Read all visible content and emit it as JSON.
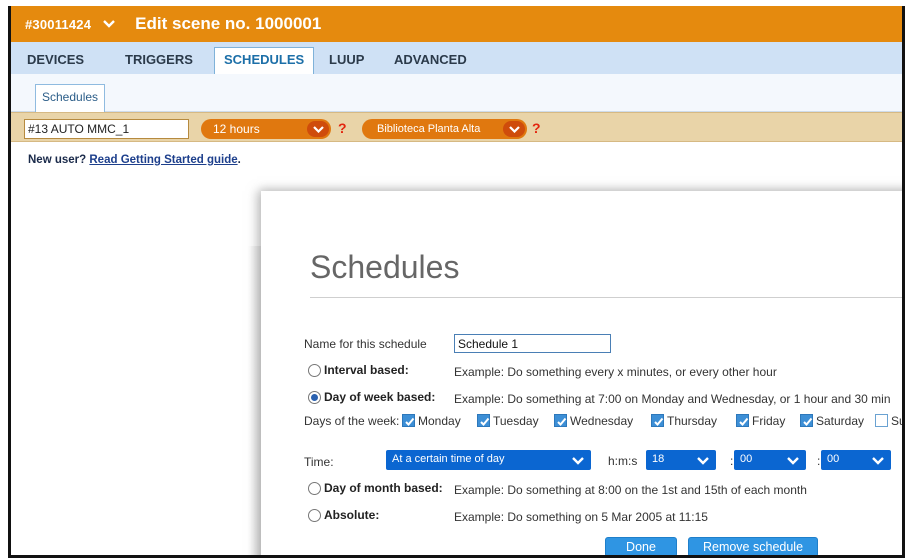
{
  "header": {
    "account": "#30011424",
    "title": "Edit scene no. 1000001"
  },
  "tabs": [
    {
      "label": "DEVICES"
    },
    {
      "label": "TRIGGERS"
    },
    {
      "label": "SCHEDULES"
    },
    {
      "label": "LUUP"
    },
    {
      "label": "ADVANCED"
    }
  ],
  "subtabs": [
    {
      "label": "Schedules"
    }
  ],
  "controls": {
    "scene_name": "#13 AUTO MMC_1",
    "interval_value": "12 hours",
    "room_value": "Biblioteca Planta Alta",
    "help": "?"
  },
  "notice": {
    "prefix": "New user?",
    "link": "Read Getting Started guide",
    "suffix": "."
  },
  "schedule": {
    "heading": "Schedules",
    "name_label": "Name for this schedule",
    "name_value": "Schedule 1",
    "types": [
      {
        "label": "Interval based:",
        "example": "Example: Do something every x minutes, or every other hour",
        "selected": false
      },
      {
        "label": "Day of week based:",
        "example": "Example: Do something at 7:00 on Monday and Wednesday, or 1 hour and 30 min",
        "selected": true
      },
      {
        "label": "Day of month based:",
        "example": "Example: Do something at 8:00 on the 1st and 15th of each month",
        "selected": false
      },
      {
        "label": "Absolute:",
        "example": "Example: Do something on 5 Mar 2005 at 11:15",
        "selected": false
      }
    ],
    "days_label": "Days of the week:",
    "days": [
      {
        "label": "Monday",
        "checked": true
      },
      {
        "label": "Tuesday",
        "checked": true
      },
      {
        "label": "Wednesday",
        "checked": true
      },
      {
        "label": "Thursday",
        "checked": true
      },
      {
        "label": "Friday",
        "checked": true
      },
      {
        "label": "Saturday",
        "checked": true
      },
      {
        "label": "Sunday",
        "checked": false
      }
    ],
    "time_label": "Time:",
    "time_mode": "At a certain time of day",
    "hms_label": "h:m:s",
    "hour": "18",
    "minute": "00",
    "second": "00",
    "sep": ":",
    "done_label": "Done",
    "remove_label": "Remove schedule"
  },
  "colors": {
    "header_orange": "#e58a0e",
    "tab_blue": "#cfe1f5",
    "control_tan": "#e9d4a8",
    "dropdown_blue": "#0b66d1",
    "button_blue": "#2f95e3"
  }
}
